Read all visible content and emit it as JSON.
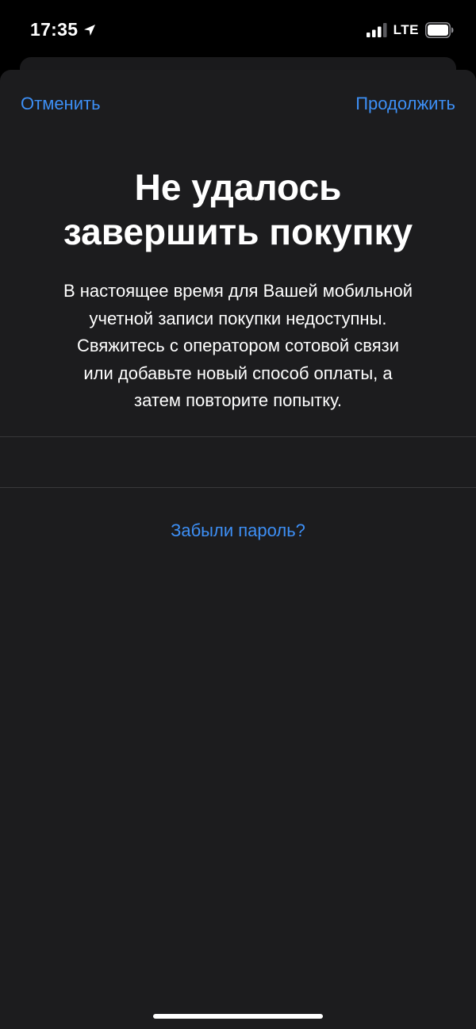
{
  "status_bar": {
    "time": "17:35",
    "network": "LTE",
    "icons": [
      "location-arrow-icon",
      "cellular-signal-icon",
      "battery-icon"
    ]
  },
  "nav": {
    "cancel_label": "Отменить",
    "continue_label": "Продолжить"
  },
  "dialog": {
    "title": "Не удалось\nзавершить покупку",
    "message": "В настоящее время для Вашей мобильной\nучетной записи покупки недоступны.\nСвяжитесь с оператором сотовой связи\nили добавьте новый способ оплаты, а\nзатем повторите попытку."
  },
  "links": {
    "forgot_password": "Забыли пароль?"
  },
  "colors": {
    "background": "#000000",
    "sheet": "#1c1c1e",
    "accent": "#3d8ff5",
    "text": "#ffffff",
    "separator": "#38383a"
  }
}
